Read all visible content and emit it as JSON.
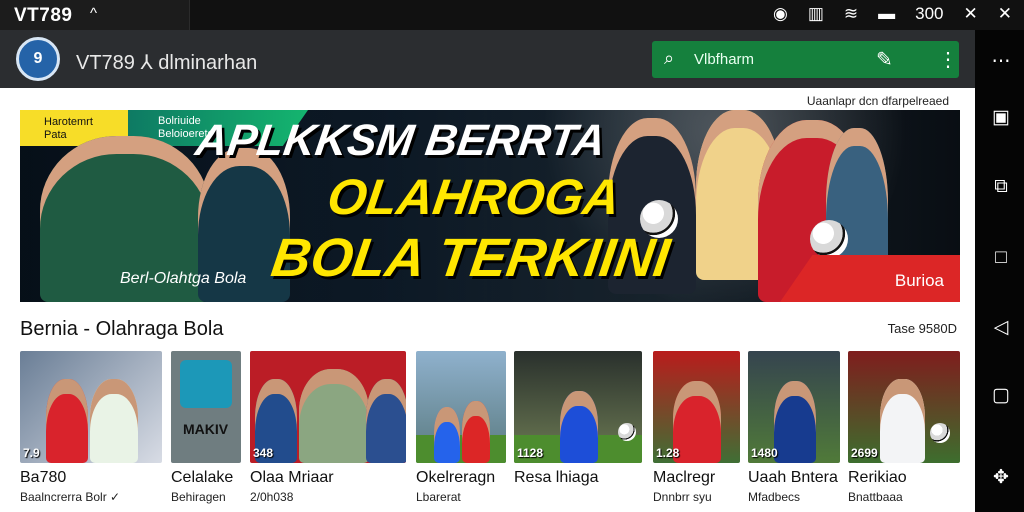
{
  "status": {
    "title": "VT789",
    "chevron": "^",
    "icons": [
      "record-icon",
      "barcode-icon",
      "wifi-icon",
      "minus-icon",
      "close-icon"
    ],
    "battery": "300"
  },
  "app": {
    "logo": "9",
    "name": "VT789 ⅄ dlminarhan"
  },
  "search": {
    "placeholder": "Vlbfharm"
  },
  "top_note": "Uaanlapr dcn dfarpelreaed",
  "hero": {
    "tab_left_line1": "Harotemrt",
    "tab_left_line2": "Pata",
    "tab_right_line1": "Bolriuide",
    "tab_right_line2": "Beloioeretoa",
    "headline_1": "APLKKSM BERRTA",
    "headline_2": "OLAHROGA",
    "headline_3": "BOLA TERKIINI",
    "caption": "Berl-Olahtga Bola",
    "badge": "Burioa"
  },
  "section": {
    "title": "Bernia - Olahraga Bola",
    "side": "Tase 9580D"
  },
  "cards": [
    {
      "title": "Ba780",
      "subtitle": "Baalncrerra Bolr ✓",
      "number": "7.9"
    },
    {
      "title": "Celalake",
      "subtitle": "Behiragen",
      "number": "",
      "label": "MAKIV"
    },
    {
      "title": "Olaa Mriaar",
      "subtitle": "2/0h038",
      "number": "348"
    },
    {
      "title": "Okelreragn",
      "subtitle": "Lbarerat",
      "number": ""
    },
    {
      "title": "Resa lhiaga",
      "subtitle": "",
      "number": "1128"
    },
    {
      "title": "Maclregr",
      "subtitle": "Dnnbrr syu",
      "number": "1.28"
    },
    {
      "title": "Uaah Bntera",
      "subtitle": "Mfadbecs",
      "number": "1480"
    },
    {
      "title": "Rerikiao",
      "subtitle": "Bnattbaaa",
      "number": "2699"
    }
  ],
  "colors": {
    "accent": "#15803d",
    "yellow": "#ffe600",
    "red": "#dc2626"
  }
}
